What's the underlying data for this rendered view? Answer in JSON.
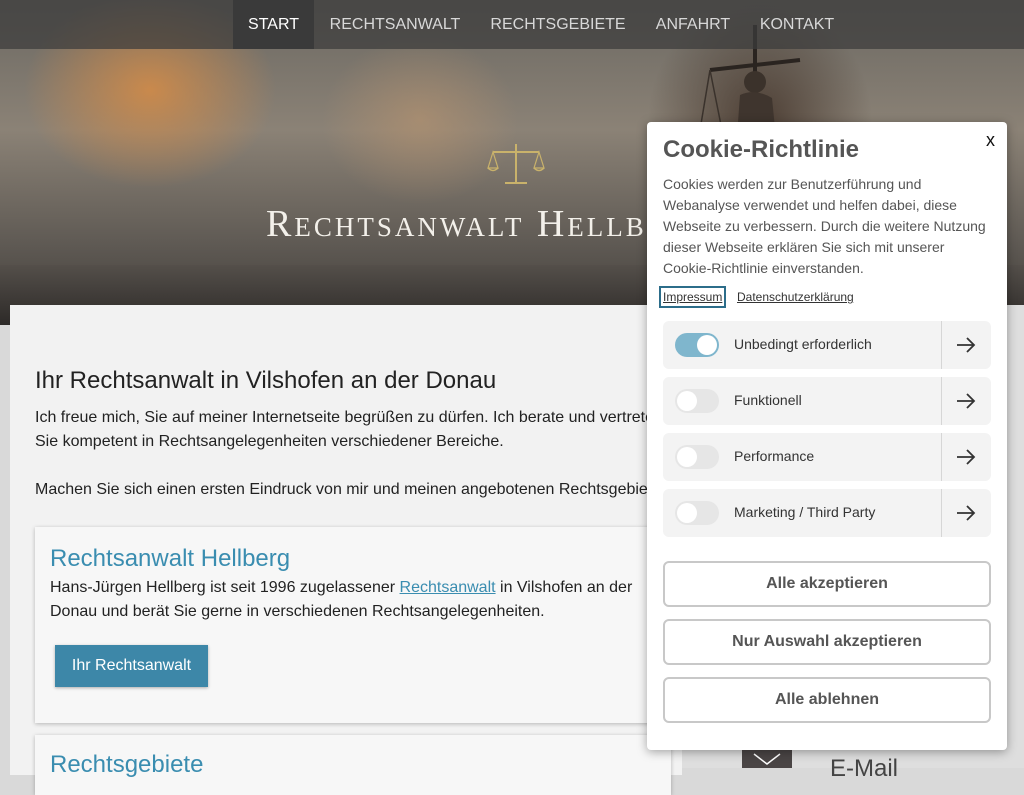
{
  "nav": {
    "items": [
      {
        "label": "START"
      },
      {
        "label": "RECHTSANWALT"
      },
      {
        "label": "RECHTSGEBIETE"
      },
      {
        "label": "ANFAHRT"
      },
      {
        "label": "KONTAKT"
      }
    ]
  },
  "hero": {
    "brand": "Rechtsanwalt Hellberg"
  },
  "main": {
    "headline": "Ihr Rechtsanwalt in Vilshofen an der Donau",
    "intro": "Ich freue mich, Sie auf meiner Internetseite begrüßen zu dürfen. Ich berate und vertrete Sie kompetent in Rechtsangelegenheiten verschiedener Bereiche.",
    "intro2": "Machen Sie sich einen ersten Eindruck von mir und meinen angebotenen Rechtsgebieten.",
    "card1": {
      "title": "Rechtsanwalt Hellberg",
      "text_before": "Hans-Jürgen Hellberg ist seit 1996 zugelassener ",
      "link": "Rechtsanwalt",
      "text_after": " in Vilshofen an der Donau und berät Sie gerne in verschiedenen Rechtsangelegenheiten.",
      "button": "Ihr Rechtsanwalt"
    },
    "card2": {
      "title": "Rechtsgebiete"
    }
  },
  "sidebar": {
    "mail_label": "E-Mail"
  },
  "cookie": {
    "close": "x",
    "title": "Cookie-Richtlinie",
    "text": "Cookies werden zur Benutzerführung und Webanalyse verwendet und helfen dabei, diese Webseite zu verbessern. Durch die weitere Nutzung dieser Webseite erklären Sie sich mit unserer Cookie-Richtlinie einverstanden.",
    "links": {
      "impressum": "Impressum",
      "datenschutz": "Datenschutzerklärung"
    },
    "categories": [
      {
        "label": "Unbedingt erforderlich",
        "enabled": true
      },
      {
        "label": "Funktionell",
        "enabled": false
      },
      {
        "label": "Performance",
        "enabled": false
      },
      {
        "label": "Marketing / Third Party",
        "enabled": false
      }
    ],
    "buttons": {
      "accept_all": "Alle akzeptieren",
      "accept_selection": "Nur Auswahl akzeptieren",
      "reject_all": "Alle ablehnen"
    }
  },
  "colors": {
    "accent": "#3a8db0",
    "button": "#3d87a8",
    "toggle_on": "#7fb6cd"
  }
}
